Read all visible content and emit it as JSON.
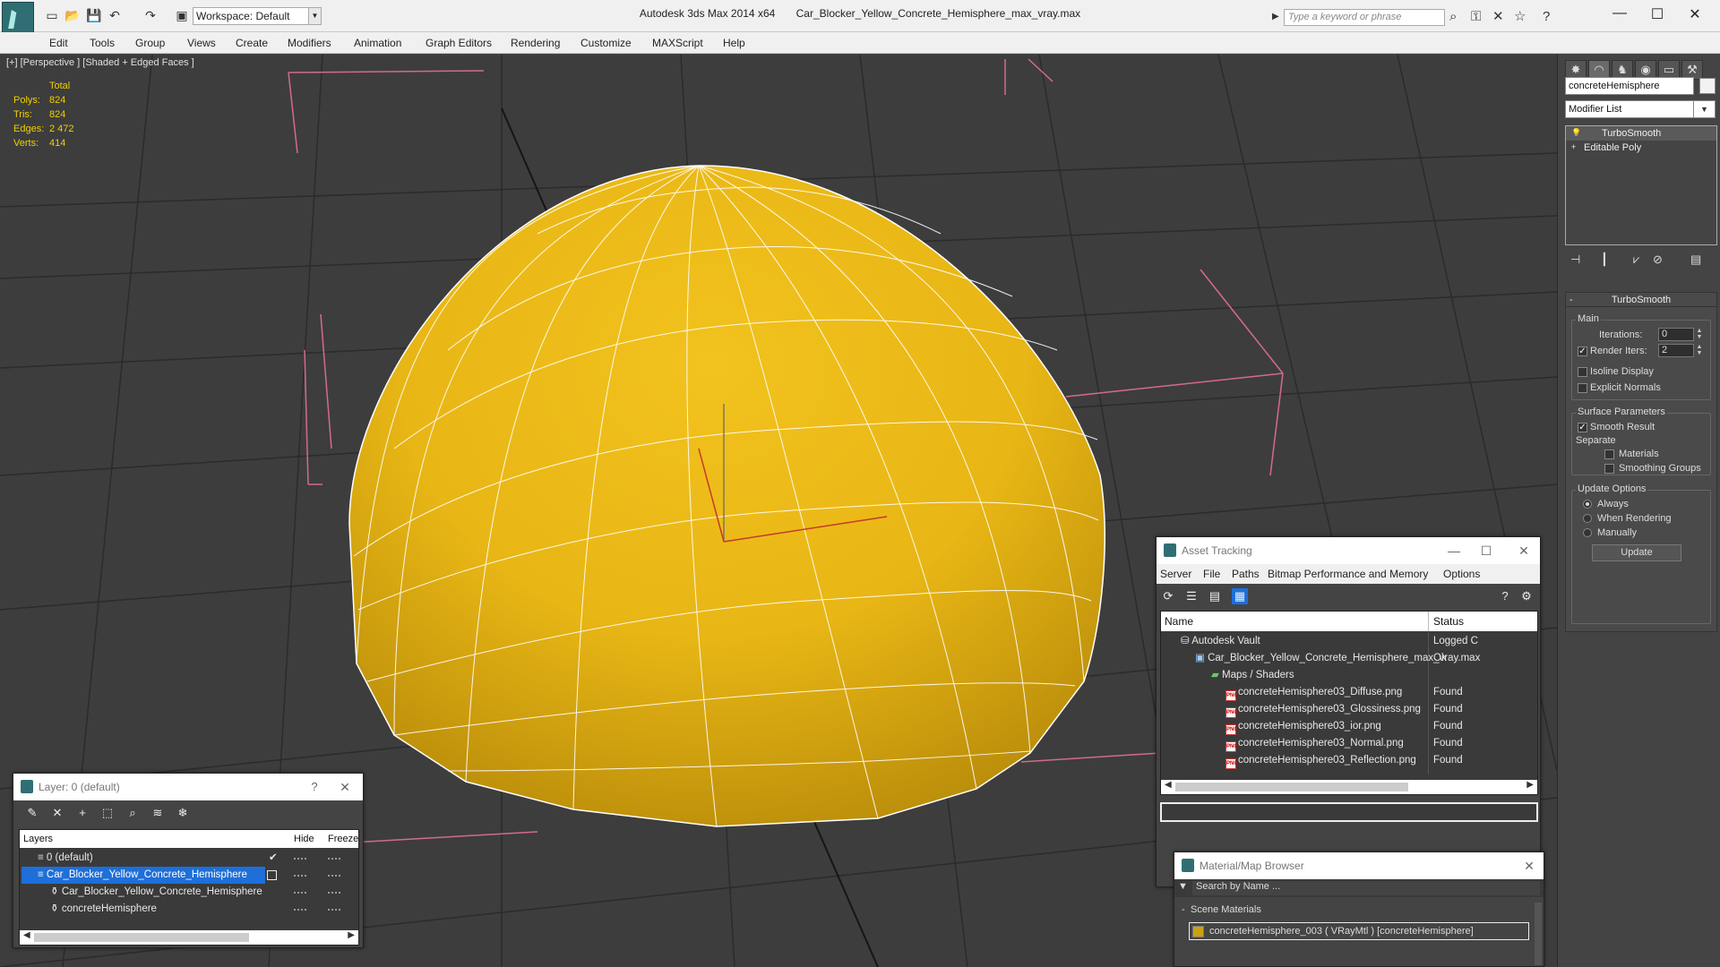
{
  "title_bar": {
    "app_name": "Autodesk 3ds Max  2014 x64",
    "file_name": "Car_Blocker_Yellow_Concrete_Hemisphere_max_vray.max",
    "workspace": "Workspace: Default",
    "search_placeholder": "Type a keyword or phrase"
  },
  "menu": [
    "Edit",
    "Tools",
    "Group",
    "Views",
    "Create",
    "Modifiers",
    "Animation",
    "Graph Editors",
    "Rendering",
    "Customize",
    "MAXScript",
    "Help"
  ],
  "viewport": {
    "label": "[+] [Perspective ] [Shaded + Edged Faces ]",
    "stats": {
      "header": "Total",
      "rows": [
        {
          "key": "Polys:",
          "value": "824"
        },
        {
          "key": "Tris:",
          "value": "824"
        },
        {
          "key": "Edges:",
          "value": "2 472"
        },
        {
          "key": "Verts:",
          "value": "414"
        }
      ]
    }
  },
  "command_panel": {
    "object_name": "concreteHemisphere",
    "modifier_list": "Modifier List",
    "stack": [
      "TurboSmooth",
      "Editable Poly"
    ],
    "rollout_title": "TurboSmooth",
    "main": {
      "title": "Main",
      "iterations_label": "Iterations:",
      "iterations": "0",
      "render_iters_label": "Render Iters:",
      "render_iters": "2",
      "isoline": "Isoline Display",
      "explicit_normals": "Explicit Normals"
    },
    "surface": {
      "title": "Surface Parameters",
      "smooth_result": "Smooth Result",
      "separate": "Separate",
      "materials": "Materials",
      "smoothing_groups": "Smoothing Groups"
    },
    "update_options": {
      "title": "Update Options",
      "always": "Always",
      "when_rendering": "When Rendering",
      "manually": "Manually",
      "update_button": "Update"
    }
  },
  "asset_tracking": {
    "title": "Asset Tracking",
    "menu": [
      "Server",
      "File",
      "Paths",
      "Bitmap Performance and Memory",
      "Options"
    ],
    "col_name": "Name",
    "col_status": "Status",
    "rows": [
      {
        "name": "Autodesk Vault",
        "status": "Logged C"
      },
      {
        "name": "Car_Blocker_Yellow_Concrete_Hemisphere_max_vray.max",
        "status": "Ok"
      },
      {
        "name": "Maps / Shaders",
        "status": ""
      },
      {
        "name": "concreteHemisphere03_Diffuse.png",
        "status": "Found"
      },
      {
        "name": "concreteHemisphere03_Glossiness.png",
        "status": "Found"
      },
      {
        "name": "concreteHemisphere03_ior.png",
        "status": "Found"
      },
      {
        "name": "concreteHemisphere03_Normal.png",
        "status": "Found"
      },
      {
        "name": "concreteHemisphere03_Reflection.png",
        "status": "Found"
      }
    ]
  },
  "material_browser": {
    "title": "Material/Map Browser",
    "search_placeholder": "Search by Name ...",
    "section": "Scene Materials",
    "item": "concreteHemisphere_003  ( VRayMtl )  [concreteHemisphere]"
  },
  "layer_dialog": {
    "title": "Layer: 0 (default)",
    "help": "?",
    "col_layers": "Layers",
    "col_hide": "Hide",
    "col_freeze": "Freeze",
    "rows": [
      {
        "name": "0 (default)"
      },
      {
        "name": "Car_Blocker_Yellow_Concrete_Hemisphere"
      },
      {
        "name": "Car_Blocker_Yellow_Concrete_Hemisphere"
      },
      {
        "name": "concreteHemisphere"
      }
    ]
  },
  "colors": {
    "dome": "#e8b615",
    "selection": "#1e6fd9",
    "stats": "#f0d000"
  }
}
